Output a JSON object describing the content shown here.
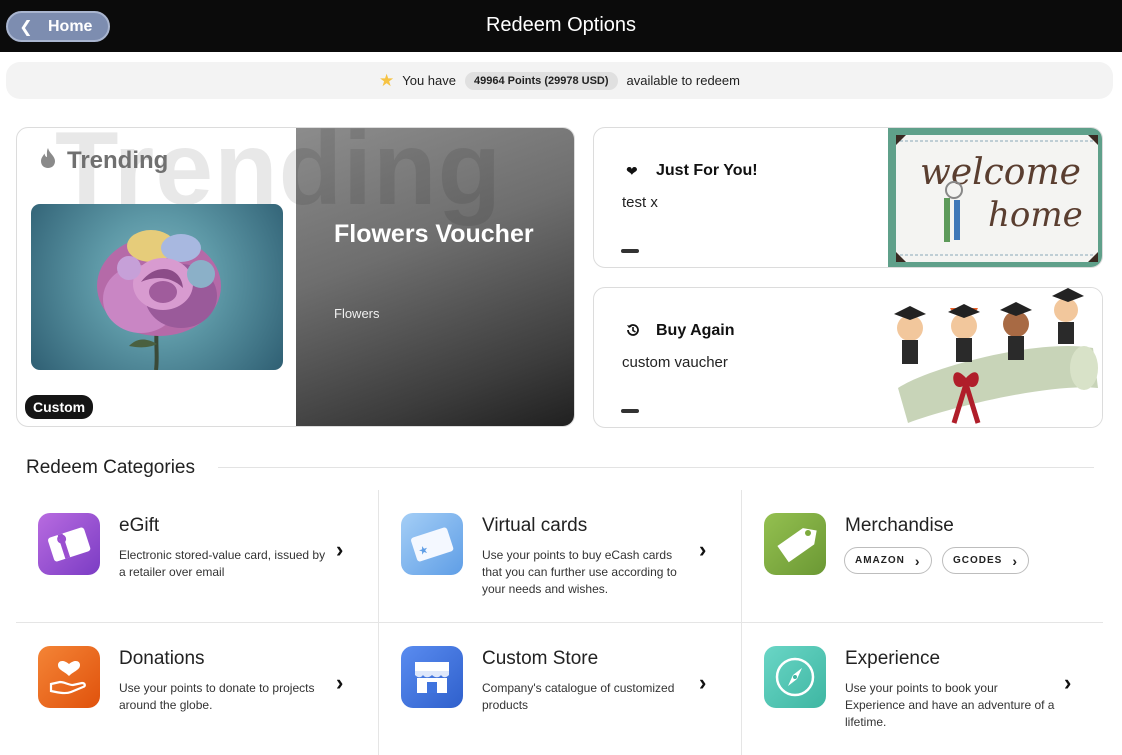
{
  "header": {
    "home_label": "Home",
    "title": "Redeem Options"
  },
  "points_bar": {
    "prefix": "You have",
    "points_text": "49964 Points (29978 USD)",
    "suffix": "available to redeem"
  },
  "trending": {
    "watermark": "Trending",
    "heading": "Trending",
    "tag": "Custom",
    "voucher_title": "Flowers Voucher",
    "voucher_category": "Flowers"
  },
  "just_for_you": {
    "heading": "Just For You!",
    "subtitle": "test x",
    "art_text_1": "welcome",
    "art_text_2": "home"
  },
  "buy_again": {
    "heading": "Buy Again",
    "subtitle": "custom vaucher"
  },
  "categories": {
    "title": "Redeem Categories",
    "items": [
      {
        "name": "eGift",
        "desc": "Electronic stored-value card, issued by a retailer over email"
      },
      {
        "name": "Virtual cards",
        "desc": "Use your points to buy eCash cards that you can further use according to your needs and wishes."
      },
      {
        "name": "Merchandise",
        "chips": [
          "AMAZON",
          "GCODES"
        ]
      },
      {
        "name": "Donations",
        "desc": "Use your points to donate to projects around the globe."
      },
      {
        "name": "Custom Store",
        "desc": "Company's catalogue of customized products"
      },
      {
        "name": "Experience",
        "desc": "Use your points to book your Experience and have an adventure of a lifetime."
      }
    ]
  },
  "colors": {
    "egift": "#9b4fd0",
    "virtual": "#7fb4ec",
    "merch": "#7daa3d",
    "donations": "#ec6a1c",
    "store": "#3f73de",
    "experience": "#52c7b3"
  }
}
